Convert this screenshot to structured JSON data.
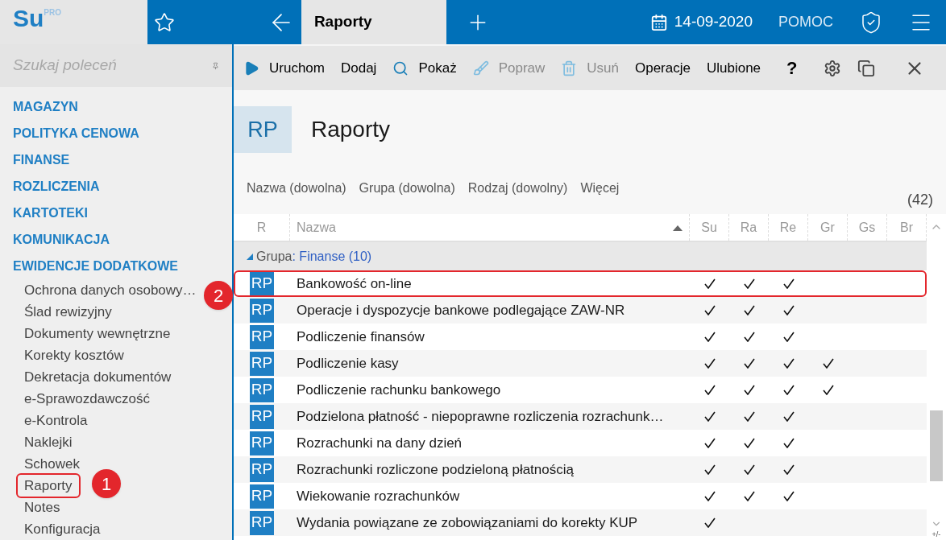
{
  "logo": {
    "text": "Su",
    "badge": "PRO"
  },
  "top_bar": {
    "active_tab": "Raporty",
    "date": "14-09-2020",
    "help": "POMOC"
  },
  "sidebar": {
    "search": {
      "placeholder": "Szukaj poleceń"
    },
    "sections": [
      {
        "label": "MAGAZYN"
      },
      {
        "label": "POLITYKA CENOWA"
      },
      {
        "label": "FINANSE"
      },
      {
        "label": "ROZLICZENIA"
      },
      {
        "label": "KARTOTEKI"
      },
      {
        "label": "KOMUNIKACJA"
      },
      {
        "label": "EWIDENCJE DODATKOWE",
        "children": [
          {
            "label": "Ochrona danych osobowy…",
            "highlighted": false
          },
          {
            "label": "Ślad rewizyjny",
            "highlighted": false
          },
          {
            "label": "Dokumenty wewnętrzne",
            "highlighted": false
          },
          {
            "label": "Korekty kosztów",
            "highlighted": false
          },
          {
            "label": "Dekretacja dokumentów",
            "highlighted": false
          },
          {
            "label": "e-Sprawozdawczość",
            "highlighted": false
          },
          {
            "label": "e-Kontrola",
            "highlighted": false
          },
          {
            "label": "Naklejki",
            "highlighted": false
          },
          {
            "label": "Schowek",
            "highlighted": false
          },
          {
            "label": "Raporty",
            "highlighted": true
          },
          {
            "label": "Notes",
            "highlighted": false
          },
          {
            "label": "Konfiguracja",
            "highlighted": false
          }
        ]
      }
    ]
  },
  "toolbar": [
    {
      "kind": "run",
      "label": "Uruchom",
      "disabled": false
    },
    {
      "kind": "text",
      "label": "Dodaj",
      "disabled": false
    },
    {
      "kind": "search",
      "label": "Pokaż",
      "disabled": false
    },
    {
      "kind": "brush",
      "label": "Popraw",
      "disabled": true
    },
    {
      "kind": "trash",
      "label": "Usuń",
      "disabled": true
    },
    {
      "kind": "text",
      "label": "Operacje",
      "disabled": false
    },
    {
      "kind": "text",
      "label": "Ulubione",
      "disabled": false
    },
    {
      "kind": "help",
      "label": "?",
      "disabled": false
    }
  ],
  "header": {
    "badge": "RP",
    "title": "Raporty"
  },
  "filters": [
    "Nazwa (dowolna)",
    "Grupa (dowolna)",
    "Rodzaj (dowolny)",
    "Więcej"
  ],
  "count": "(42)",
  "table": {
    "columns": [
      "R",
      "Nazwa",
      "Su",
      "Ra",
      "Re",
      "Gr",
      "Gs",
      "Br"
    ],
    "group": {
      "label": "Grupa",
      "value": ": Finanse (10)",
      "expanded": true
    },
    "rows": [
      {
        "icon": "RP",
        "name": "Bankowość on-line",
        "checks": [
          true,
          true,
          true,
          false,
          false,
          false
        ],
        "highlighted": true
      },
      {
        "icon": "RP",
        "name": "Operacje i dyspozycje bankowe podlegające ZAW-NR",
        "checks": [
          true,
          true,
          true,
          false,
          false,
          false
        ],
        "highlighted": false
      },
      {
        "icon": "RP",
        "name": "Podliczenie finansów",
        "checks": [
          true,
          true,
          true,
          false,
          false,
          false
        ],
        "highlighted": false
      },
      {
        "icon": "RP",
        "name": "Podliczenie kasy",
        "checks": [
          true,
          true,
          true,
          true,
          false,
          false
        ],
        "highlighted": false
      },
      {
        "icon": "RP",
        "name": "Podliczenie rachunku bankowego",
        "checks": [
          true,
          true,
          true,
          true,
          false,
          false
        ],
        "highlighted": false
      },
      {
        "icon": "RP",
        "name": "Podzielona płatność - niepoprawne rozliczenia rozrachunk…",
        "checks": [
          true,
          true,
          true,
          false,
          false,
          false
        ],
        "highlighted": false
      },
      {
        "icon": "RP",
        "name": "Rozrachunki na dany dzień",
        "checks": [
          true,
          true,
          true,
          false,
          false,
          false
        ],
        "highlighted": false
      },
      {
        "icon": "RP",
        "name": "Rozrachunki rozliczone podzieloną płatnością",
        "checks": [
          true,
          true,
          true,
          false,
          false,
          false
        ],
        "highlighted": false
      },
      {
        "icon": "RP",
        "name": "Wiekowanie rozrachunków",
        "checks": [
          true,
          true,
          true,
          false,
          false,
          false
        ],
        "highlighted": false
      },
      {
        "icon": "RP",
        "name": "Wydania powiązane ze zobowiązaniami do korekty KUP",
        "checks": [
          true,
          false,
          false,
          false,
          false,
          false
        ],
        "highlighted": false
      }
    ],
    "scroll_toggle": "+/-"
  },
  "annotations": [
    {
      "label": "1"
    },
    {
      "label": "2"
    }
  ]
}
